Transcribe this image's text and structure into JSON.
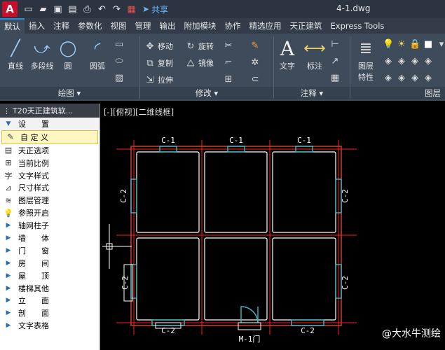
{
  "app": {
    "logo_letter": "A",
    "doc_title": "4-1.dwg",
    "share_label": "共享"
  },
  "quick_access": [
    "new-icon",
    "open-icon",
    "save-icon",
    "saveas-icon",
    "print-icon",
    "undo-icon",
    "redo-icon",
    "dwf-icon"
  ],
  "tabs": [
    "默认",
    "插入",
    "注释",
    "参数化",
    "视图",
    "管理",
    "输出",
    "附加模块",
    "协作",
    "精选应用",
    "天正建筑",
    "Express Tools"
  ],
  "ribbon": {
    "draw": {
      "label": "绘图",
      "buttons": [
        "直线",
        "多段线",
        "圆",
        "圆弧"
      ]
    },
    "modify": {
      "label": "修改",
      "rows": [
        [
          "移动",
          "旋转"
        ],
        [
          "复制",
          "镜像"
        ],
        [
          "拉伸"
        ]
      ]
    },
    "annotation": {
      "label": "注释",
      "buttons": [
        "文字",
        "标注"
      ]
    },
    "layers": {
      "label": "图层",
      "button": "图层\n特性",
      "button_l1": "图层",
      "button_l2": "特性"
    }
  },
  "palette": {
    "title": "T20天正建筑软...",
    "items": [
      {
        "label": "设　　置",
        "kind": "header"
      },
      {
        "label": "自 定 义",
        "kind": "item",
        "highlight": true
      },
      {
        "label": "天正选项",
        "kind": "item"
      },
      {
        "label": "当前比例",
        "kind": "item"
      },
      {
        "label": "文字样式",
        "kind": "item"
      },
      {
        "label": "尺寸样式",
        "kind": "item"
      },
      {
        "label": "图层管理",
        "kind": "item"
      },
      {
        "label": "参照开启",
        "kind": "item"
      },
      {
        "label": "轴网柱子",
        "kind": "menu"
      },
      {
        "label": "墙　　体",
        "kind": "menu"
      },
      {
        "label": "门　　窗",
        "kind": "menu"
      },
      {
        "label": "房　　间",
        "kind": "menu"
      },
      {
        "label": "屋　　顶",
        "kind": "menu"
      },
      {
        "label": "楼梯其他",
        "kind": "menu"
      },
      {
        "label": "立　　面",
        "kind": "menu"
      },
      {
        "label": "剖　　面",
        "kind": "menu"
      },
      {
        "label": "文字表格",
        "kind": "menu"
      }
    ]
  },
  "canvas": {
    "view_label": "[-][俯视][二维线框]",
    "labels": {
      "c1": "C-1",
      "c2": "C-2",
      "m1": "M-1门"
    },
    "watermark": "@大水牛测绘"
  },
  "colors": {
    "wall": "#c0392b",
    "window": "#3fb8c6",
    "axis": "#ff2020",
    "text": "#ffffff"
  }
}
